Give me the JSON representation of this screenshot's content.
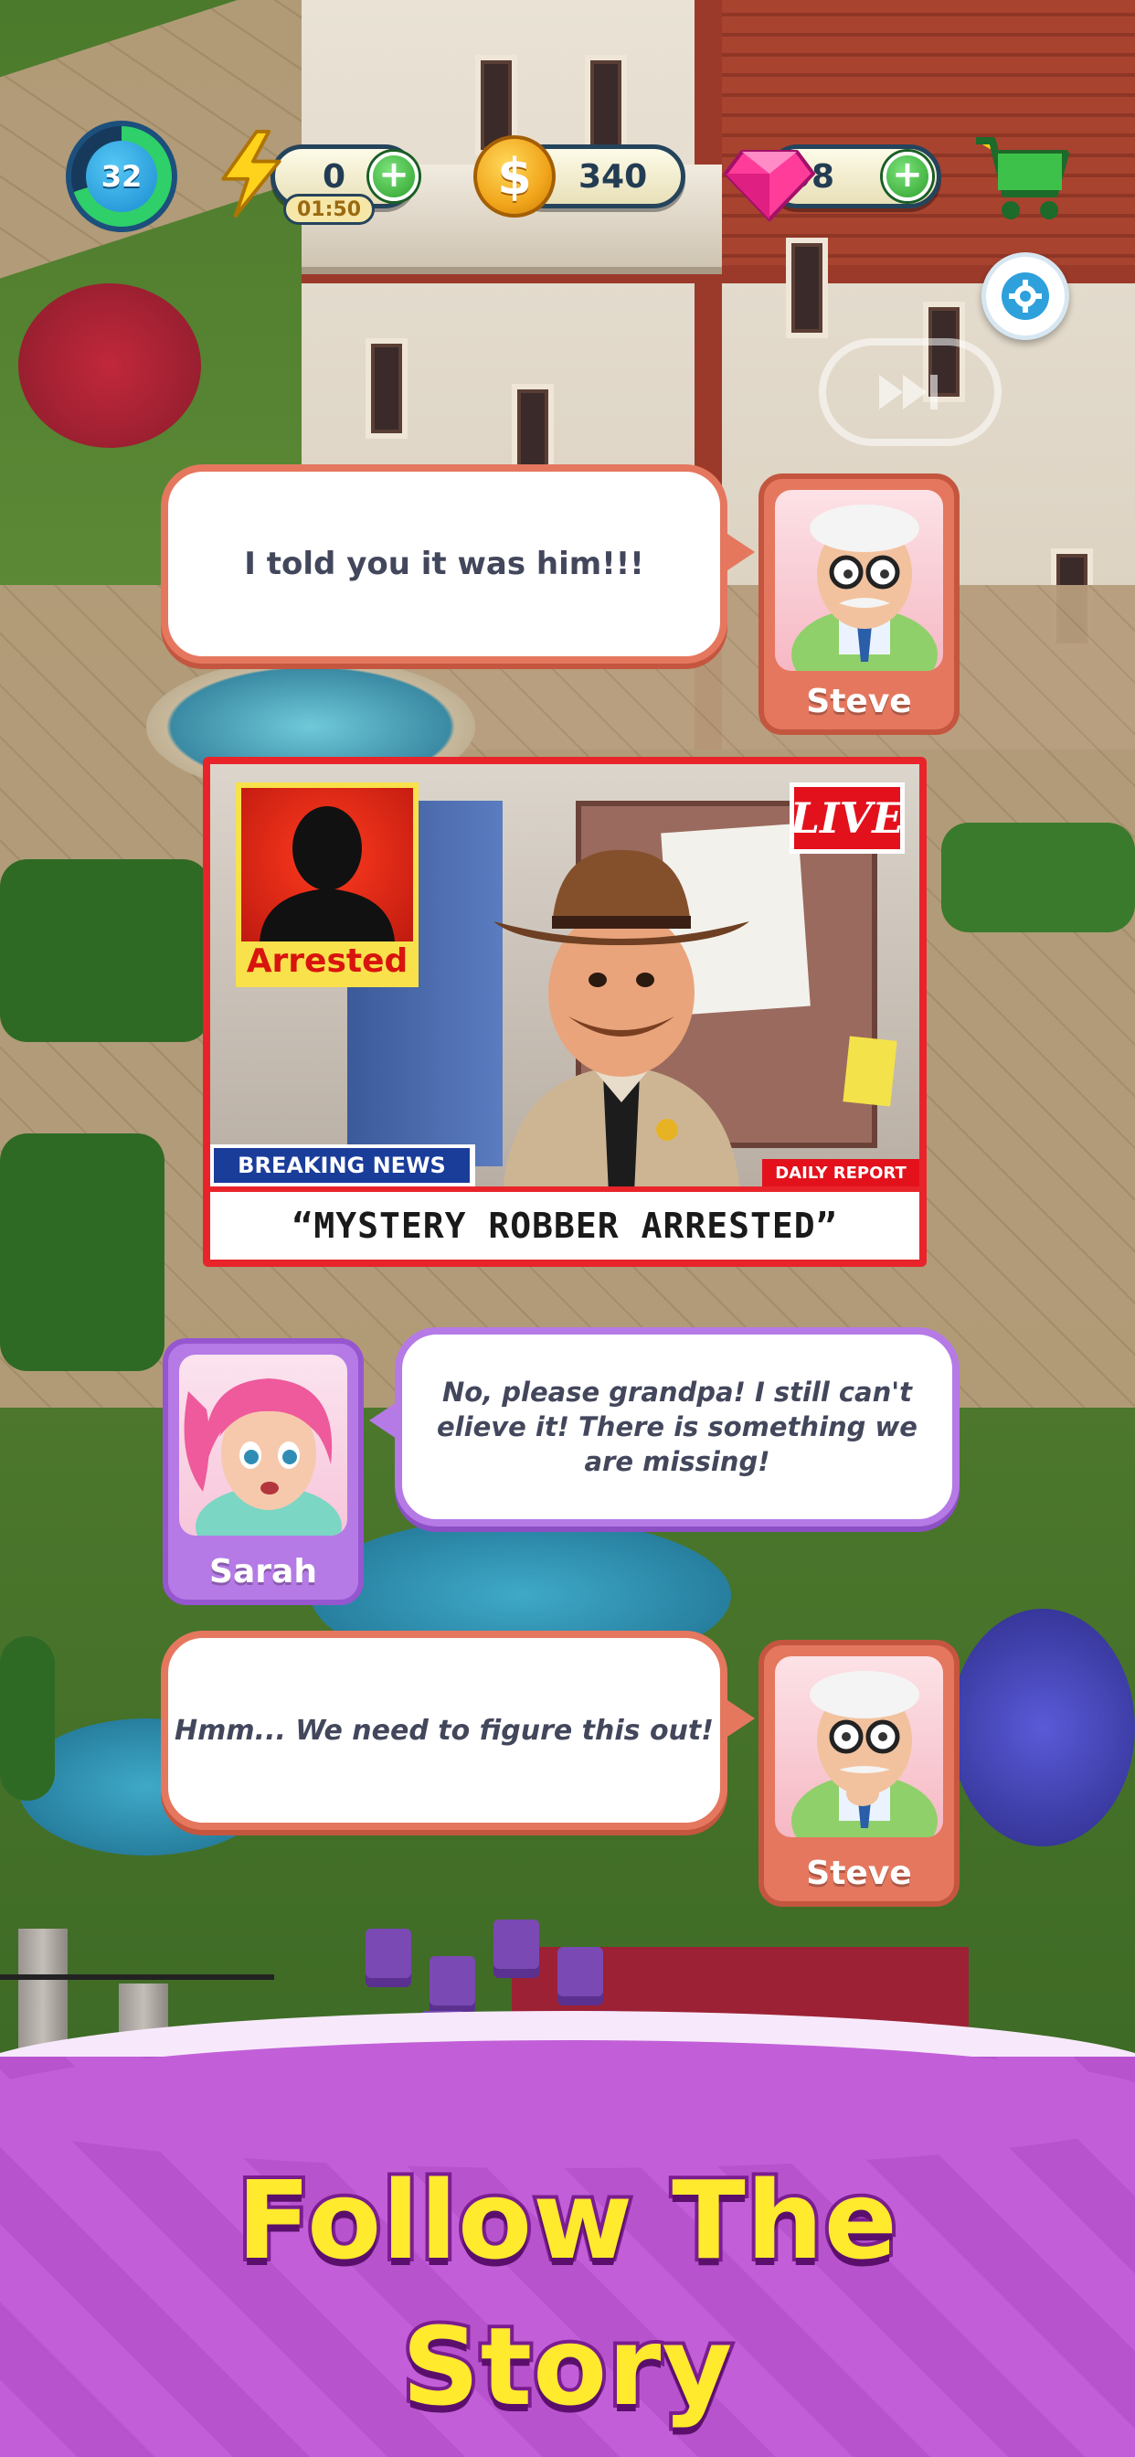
{
  "hud": {
    "level": "32",
    "energy": {
      "value": "0",
      "timer": "01:50"
    },
    "coins": {
      "value": "340"
    },
    "gems": {
      "value": "98"
    },
    "plus_symbol": "+"
  },
  "dialogue": [
    {
      "speaker": "Steve",
      "text": "I told you it was him!!!",
      "style": "normal"
    },
    {
      "speaker": "Sarah",
      "text": "No, please grandpa! I still can't elieve it! There is something we are missing!",
      "style": "italic"
    },
    {
      "speaker": "Steve",
      "text": "Hmm... We need to figure this out!",
      "style": "italic"
    }
  ],
  "news": {
    "arrested_label": "Arrested",
    "live_label": "LIVE",
    "breaking_label": "BREAKING NEWS",
    "daily_label": "DAILY REPORT",
    "headline": "“MYSTERY ROBBER ARRESTED”"
  },
  "banner": {
    "line1": "Follow The",
    "line2": "Story"
  },
  "colors": {
    "steve_frame": "#e5775f",
    "sarah_frame": "#b57ae6",
    "banner_bg": "#c25fd8",
    "banner_text": "#ffea2e"
  },
  "icons": [
    "level-ring-icon",
    "lightning-icon",
    "coin-icon",
    "gem-icon",
    "cart-icon",
    "gear-icon",
    "skip-icon"
  ]
}
